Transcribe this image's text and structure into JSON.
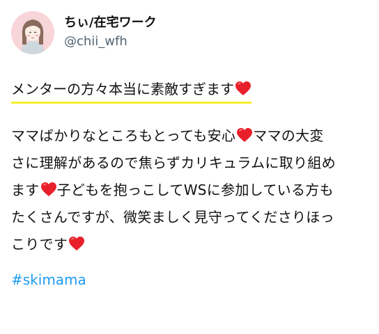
{
  "tweet": {
    "author": {
      "display_name": "ちぃ/在宅ワーク",
      "handle": "@chii_wfh",
      "avatar_icon": "illustrated-woman-avatar-icon"
    },
    "headline": "メンターの方々本当に素敵すぎます",
    "body_lines": [
      "ママばかりなところもとっても安心",
      "ママの大変",
      "さに理解があるので焦らずカリキュラムに取り組め",
      "ます",
      "子どもを抱っこしてWSに参加している方も",
      "たくさんですが、微笑ましく見守ってくださりほっ",
      "こりです"
    ],
    "hashtag": "#skimama",
    "emoji": "red-heart-icon",
    "colors": {
      "highlight": "#f7ee2b",
      "hashtag": "#1d9bf0",
      "heart": "#e8202b",
      "avatar_bg": "#f8d5d8"
    }
  }
}
